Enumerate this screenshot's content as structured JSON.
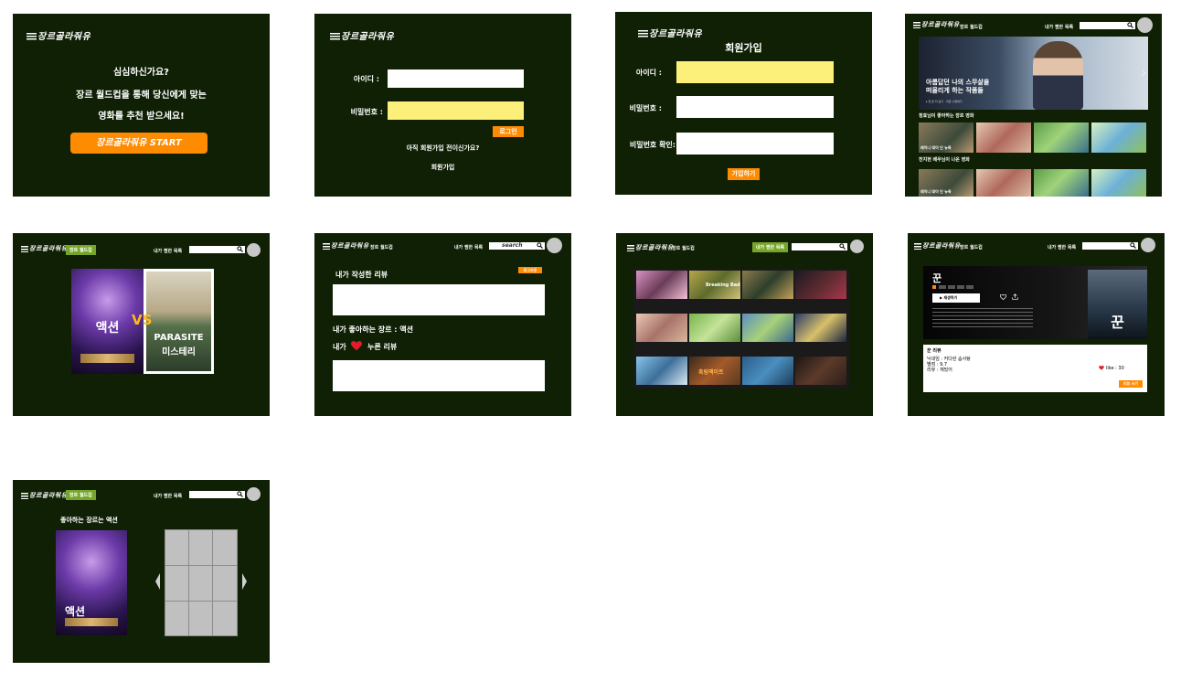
{
  "logo": "장르골라줘유",
  "start": {
    "line1": "심심하신가요?",
    "line2": "장르 월드컵을 통해 당신에게 맞는",
    "line3": "영화를 추천 받으세요!",
    "button": "장르골라줘유 START"
  },
  "login": {
    "id_label": "아이디 :",
    "pw_label": "비밀번호 :",
    "login_button": "로그인",
    "prompt": "아직 회원가입 전이신가요?",
    "signup_link": "회원가입"
  },
  "signup": {
    "title": "회원가입",
    "id_label": "아이디 :",
    "pw_label": "비밀번호 :",
    "pw_confirm_label": "비밀번호  확인:",
    "button": "가입하기"
  },
  "nav": {
    "genre_worldcup": "장르 월드컵",
    "my_list": "내가 찜한 목록",
    "search_placeholder": "search"
  },
  "home": {
    "banner_title": "아름답던 나의 스무살을\n떠올리게 하는 작품들",
    "banner_sub": "▸ 한 번 더 보기 · 지금 시청하기",
    "row1_title": "정효님이 좋아하는 장르 영화",
    "row2_title": "전지현 배우님이 나온 영화",
    "thumb_labels": [
      "레이니 데이 인 뉴욕",
      "",
      "",
      ""
    ]
  },
  "worldcup": {
    "left_caption": "액션",
    "vs": "VS",
    "right_title": "PARASITE",
    "right_caption": "미스테리"
  },
  "mypage": {
    "logout": "로그아웃",
    "my_reviews": "내가 작성한 리뷰",
    "fav_genre": "내가 좋아하는 장르 : 액션",
    "liked_prefix": "내가",
    "liked_suffix": "누른 리뷰"
  },
  "mylist": {
    "tiles": [
      "",
      "Breaking Bad",
      "",
      "",
      "",
      "",
      "",
      "",
      "",
      "흑림액이트",
      "",
      ""
    ]
  },
  "detail": {
    "title": "꾼",
    "play_button": "▶ 재생하기",
    "review_title": "꾼 리뷰",
    "review_lines": [
      "닉네임 : 커다란 솜사탕",
      "별점 : 9.7",
      "리뷰 : 재밌어"
    ],
    "like_text": "like : 30",
    "write_button": "리뷰 쓰기"
  },
  "result": {
    "title": "좋아하는 장르는 액션",
    "poster_caption": "액션"
  },
  "colors": {
    "panel_bg": "#0f2004",
    "accent_orange": "#ff8b00",
    "field_yellow": "#fdf07a",
    "nav_green": "#77a52a",
    "heart": "#e11d2b"
  }
}
